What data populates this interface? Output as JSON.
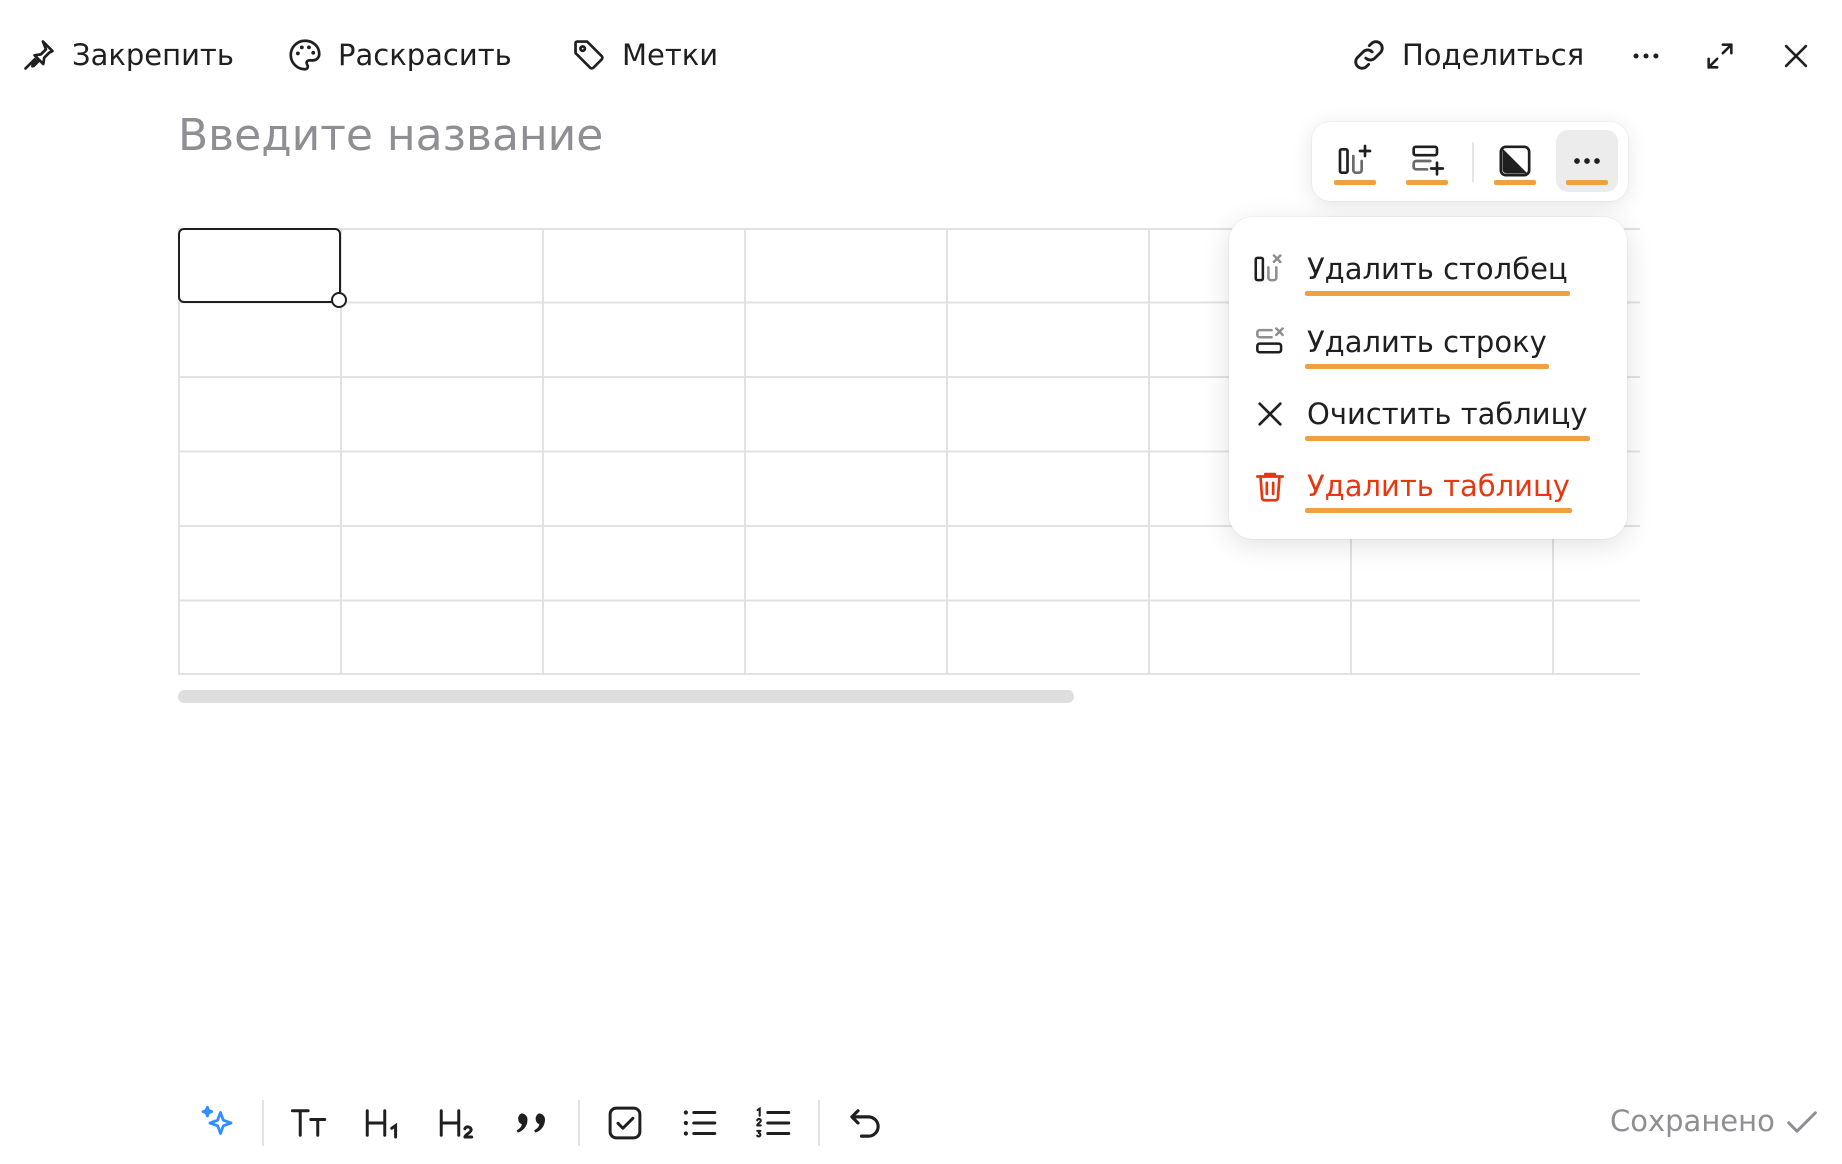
{
  "colors": {
    "accent": "#f0a040",
    "danger": "#e8370f",
    "text": "#1f1f1f",
    "muted": "#8e8e93",
    "grid": "#e2e2e2",
    "ai": "#2f8fff"
  },
  "toolbar": {
    "pin": {
      "label": "Закрепить",
      "icon": "pin-icon"
    },
    "color": {
      "label": "Раскрасить",
      "icon": "palette-icon"
    },
    "labels": {
      "label": "Метки",
      "icon": "tag-icon"
    },
    "share": {
      "label": "Поделиться",
      "icon": "link-icon"
    },
    "more_icon": "more-horizontal-icon",
    "expand_icon": "expand-icon",
    "close_icon": "close-icon"
  },
  "note": {
    "title_placeholder": "Введите название"
  },
  "table": {
    "rows": 6,
    "columns_visible": 8,
    "selected_cell": [
      0,
      0
    ]
  },
  "table_tools": [
    {
      "name": "add-column",
      "icon": "add-column-icon"
    },
    {
      "name": "add-row",
      "icon": "add-row-icon"
    },
    {
      "name": "cell-color",
      "icon": "contrast-icon"
    },
    {
      "name": "more",
      "icon": "more-horizontal-icon",
      "active": true
    }
  ],
  "menu": {
    "items": [
      {
        "label": "Удалить столбец",
        "icon": "delete-column-icon"
      },
      {
        "label": "Удалить строку",
        "icon": "delete-row-icon"
      },
      {
        "label": "Очистить таблицу",
        "icon": "clear-icon"
      },
      {
        "label": "Удалить таблицу",
        "icon": "trash-icon",
        "danger": true
      }
    ]
  },
  "bottom": {
    "tools": [
      {
        "name": "ai",
        "icon": "sparkle-icon"
      },
      {
        "name": "text",
        "icon": "text-style-icon",
        "glyph": "Тт"
      },
      {
        "name": "h1",
        "icon": "heading1-icon",
        "glyph": "H",
        "sub": "1"
      },
      {
        "name": "h2",
        "icon": "heading2-icon",
        "glyph": "H",
        "sub": "2"
      },
      {
        "name": "quote",
        "icon": "quote-icon"
      },
      {
        "name": "checkbox",
        "icon": "checkbox-icon"
      },
      {
        "name": "bullets",
        "icon": "bullet-list-icon"
      },
      {
        "name": "numbered",
        "icon": "numbered-list-icon"
      },
      {
        "name": "undo",
        "icon": "undo-icon"
      }
    ],
    "status": "Сохранено"
  }
}
